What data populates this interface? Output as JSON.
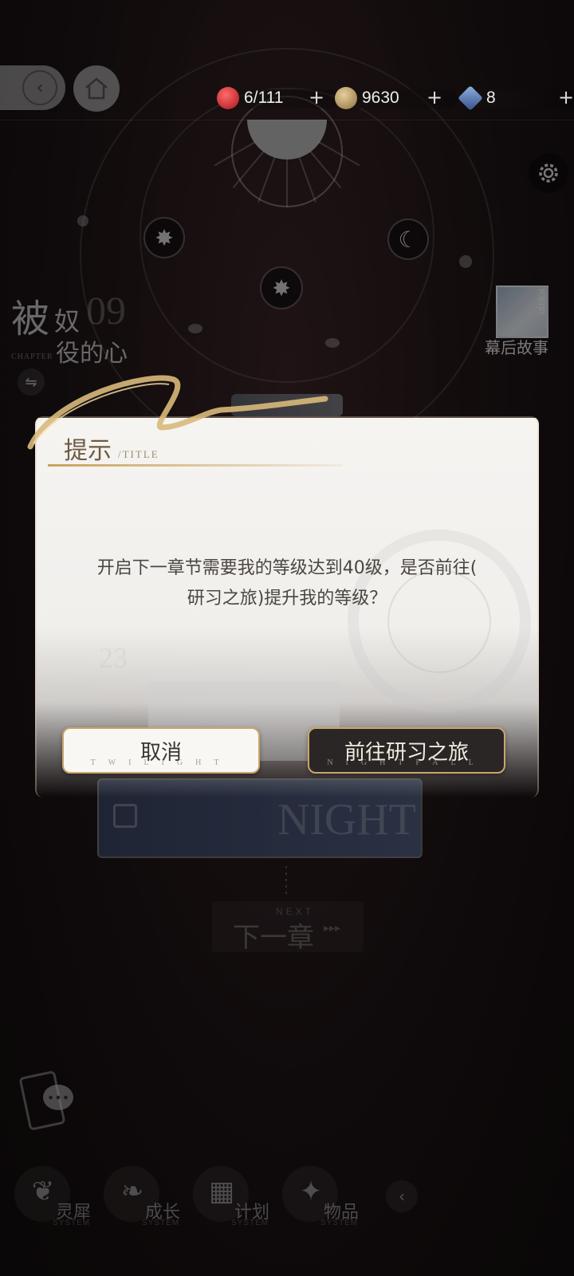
{
  "resources": [
    {
      "name": "stamina",
      "value": "6/111",
      "icon": "apple-icon",
      "color": "#c0272d"
    },
    {
      "name": "coins",
      "value": "9630",
      "icon": "coin-icon",
      "color": "#b89a64"
    },
    {
      "name": "gems",
      "value": "8",
      "icon": "diamond-icon",
      "color": "#5a7bb0"
    }
  ],
  "resource_plus": "+",
  "chapter": {
    "title_big": "被",
    "title_mid": "奴",
    "number": "09",
    "title_sub": "役的心",
    "label": "CHAPTER"
  },
  "story_thumb": {
    "label": "幕后故事",
    "tag": "POETRY"
  },
  "background": {
    "night_text": "NIGHT",
    "number_text": "23",
    "next_small": "NEXT",
    "next_big": "下一章"
  },
  "dialog": {
    "title": "提示",
    "subtitle": "/TITLE",
    "message_line1": "开启下一章节需要我的等级达到40级，是否前往(",
    "message_line2": "研习之旅)提升我的等级？",
    "cancel_label": "取消",
    "cancel_en": "TWILIGHT",
    "confirm_label": "前往研习之旅",
    "confirm_en": "NIGHTFALL"
  },
  "nav": [
    {
      "label": "灵犀",
      "sub": "SYSTEM",
      "icon": "wings-icon"
    },
    {
      "label": "成长",
      "sub": "SYSTEM",
      "icon": "leaf-icon"
    },
    {
      "label": "计划",
      "sub": "SYSTEM",
      "icon": "calendar-icon"
    },
    {
      "label": "物品",
      "sub": "SYSTEM",
      "icon": "stars-icon"
    }
  ]
}
